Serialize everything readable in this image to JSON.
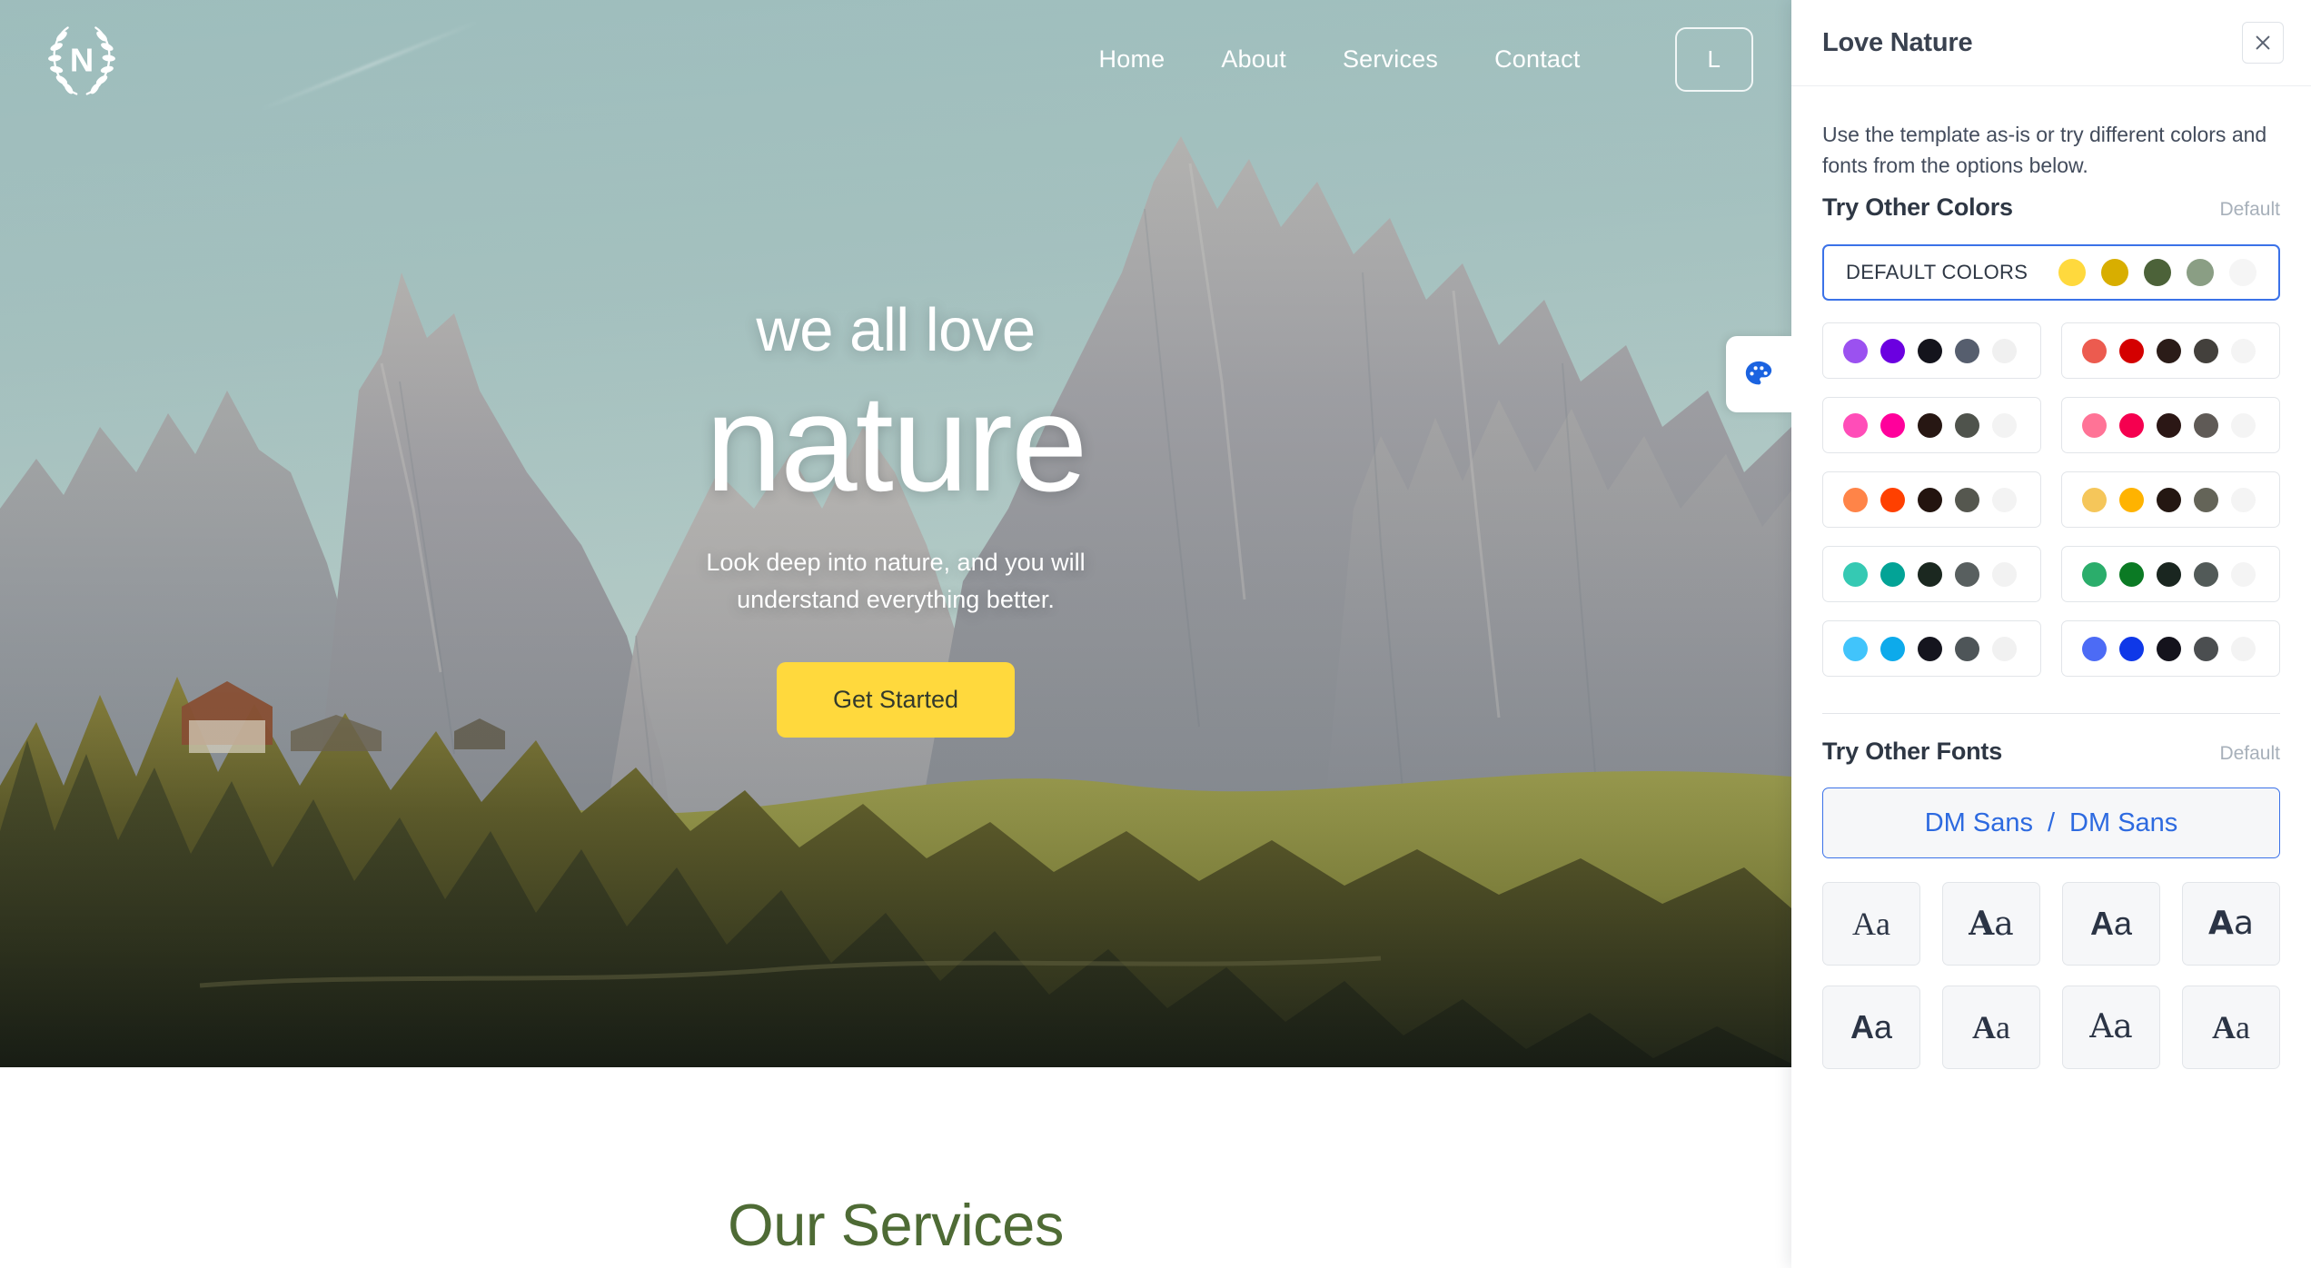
{
  "website": {
    "logo_letter": "N",
    "logo_name": "laurel-wreath-logo",
    "nav": [
      {
        "label": "Home"
      },
      {
        "label": "About"
      },
      {
        "label": "Services"
      },
      {
        "label": "Contact"
      }
    ],
    "cta_label": "L",
    "hero": {
      "kicker": "we all love",
      "title": "nature",
      "subtitle_line1": "Look deep into nature, and you will",
      "subtitle_line2": "understand everything better.",
      "button_label": "Get Started"
    },
    "services": {
      "title": "Our Services"
    },
    "accent_color": "#FFD93D",
    "services_title_color": "#4E6B35",
    "palette_tab_icon": "palette-icon",
    "palette_icon_color": "#1B63E0"
  },
  "panel": {
    "title": "Love Nature",
    "close_icon": "close-icon",
    "description": "Use the template as-is or try different colors and fonts from the options below.",
    "colors": {
      "heading": "Try Other Colors",
      "default_link": "Default",
      "active_label": "DEFAULT COLORS",
      "active_swatches": [
        "#FFD93D",
        "#D8AE00",
        "#4C6239",
        "#8A9E84",
        "#F5F5F5"
      ],
      "palettes": [
        {
          "name": "purple",
          "swatches": [
            "#9B51F0",
            "#6B00E0",
            "#14141C",
            "#565E6E",
            "#F0F0F0"
          ]
        },
        {
          "name": "red",
          "swatches": [
            "#EC5B4F",
            "#D40000",
            "#2B1C18",
            "#43403C",
            "#F4F4F4"
          ]
        },
        {
          "name": "hot-pink",
          "swatches": [
            "#FF4DB8",
            "#FF009B",
            "#271713",
            "#4F534C",
            "#F3F3F3"
          ]
        },
        {
          "name": "rose",
          "swatches": [
            "#FF7396",
            "#F5004F",
            "#2B1715",
            "#5F5A56",
            "#F4F4F4"
          ]
        },
        {
          "name": "orange",
          "swatches": [
            "#FF8448",
            "#FF4000",
            "#23140F",
            "#55574F",
            "#F3F3F3"
          ]
        },
        {
          "name": "amber",
          "swatches": [
            "#F5C65A",
            "#FFB300",
            "#241712",
            "#646458",
            "#F4F4F4"
          ]
        },
        {
          "name": "turquoise",
          "swatches": [
            "#35C9B3",
            "#03A396",
            "#1B2820",
            "#585F5F",
            "#F2F2F2"
          ]
        },
        {
          "name": "green",
          "swatches": [
            "#2BAD6B",
            "#0B7A24",
            "#1A2620",
            "#525A58",
            "#F4F4F4"
          ]
        },
        {
          "name": "sky-blue",
          "swatches": [
            "#41C4FB",
            "#0DAAEB",
            "#15151E",
            "#4E5558",
            "#F1F1F1"
          ]
        },
        {
          "name": "royal-blue",
          "swatches": [
            "#4C6BF5",
            "#0F38E8",
            "#14131C",
            "#4B4E50",
            "#F3F3F3"
          ]
        }
      ]
    },
    "fonts": {
      "heading": "Try Other Fonts",
      "default_link": "Default",
      "active_heading_font": "DM Sans",
      "active_separator": "/",
      "active_body_font": "DM Sans",
      "tiles": [
        {
          "sample": "Aa",
          "style": "serif-thin"
        },
        {
          "sample": "Aa",
          "style": "slab-bold"
        },
        {
          "sample": "Aa",
          "style": "sans-bold"
        },
        {
          "sample": "Aa",
          "style": "sans-heavy"
        },
        {
          "sample": "Aa",
          "style": "sans-bold-2"
        },
        {
          "sample": "Aa",
          "style": "serif-bold"
        },
        {
          "sample": "Aa",
          "style": "serif-regular"
        },
        {
          "sample": "Aa",
          "style": "serif-heavy"
        }
      ]
    }
  }
}
